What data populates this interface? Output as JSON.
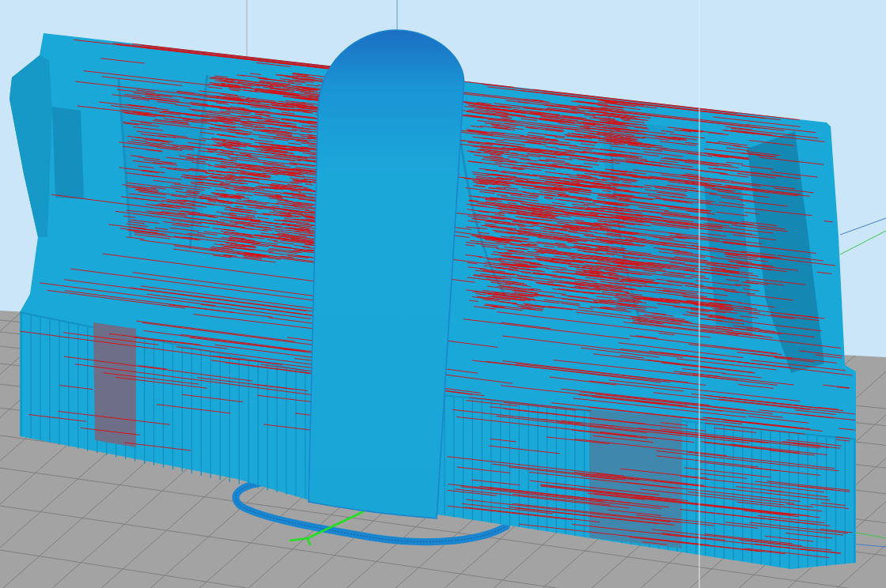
{
  "viewport": {
    "show_grid": true,
    "show_travel_moves": true
  }
}
